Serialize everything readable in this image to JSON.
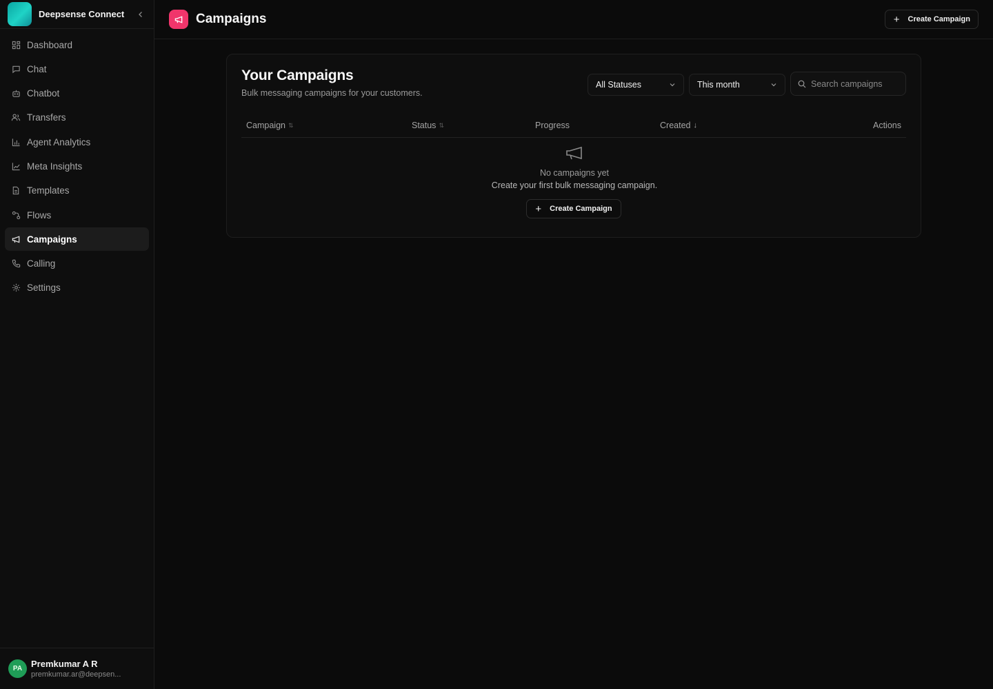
{
  "app": {
    "name": "Deepsense Connect"
  },
  "sidebar": {
    "items": [
      {
        "label": "Dashboard",
        "icon": "dashboard-icon"
      },
      {
        "label": "Chat",
        "icon": "chat-icon"
      },
      {
        "label": "Chatbot",
        "icon": "bot-icon"
      },
      {
        "label": "Transfers",
        "icon": "users-icon"
      },
      {
        "label": "Agent Analytics",
        "icon": "bar-chart-icon"
      },
      {
        "label": "Meta Insights",
        "icon": "line-chart-icon"
      },
      {
        "label": "Templates",
        "icon": "document-icon"
      },
      {
        "label": "Flows",
        "icon": "flow-icon"
      },
      {
        "label": "Campaigns",
        "icon": "megaphone-icon",
        "active": true
      },
      {
        "label": "Calling",
        "icon": "phone-icon"
      },
      {
        "label": "Settings",
        "icon": "gear-icon"
      }
    ]
  },
  "user": {
    "initials": "PA",
    "name": "Premkumar A R",
    "email": "premkumar.ar@deepsen..."
  },
  "header": {
    "title": "Campaigns",
    "create_label": "Create Campaign"
  },
  "campaigns": {
    "title": "Your Campaigns",
    "subtitle": "Bulk messaging campaigns for your customers.",
    "filters": {
      "status": "All Statuses",
      "period": "This month"
    },
    "search": {
      "placeholder": "Search campaigns"
    },
    "columns": {
      "campaign": "Campaign",
      "status": "Status",
      "progress": "Progress",
      "created": "Created",
      "actions": "Actions"
    },
    "empty": {
      "title": "No campaigns yet",
      "subtitle": "Create your first bulk messaging campaign.",
      "button": "Create Campaign"
    }
  },
  "colors": {
    "accent": "#f0356b",
    "brand": "#1fd3c6",
    "avatar": "#1f9d57"
  }
}
